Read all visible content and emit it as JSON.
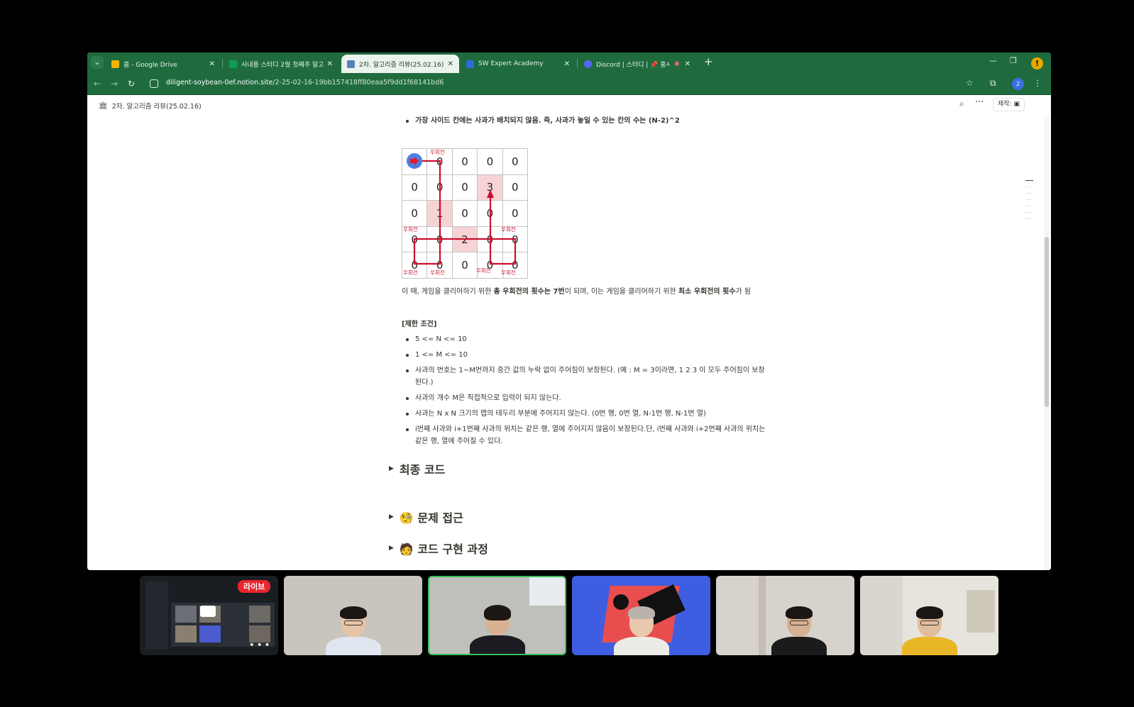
{
  "browser": {
    "tabs": [
      {
        "title": "흠 - Google Drive",
        "favicon": "drive-icon",
        "color": "#f4b400"
      },
      {
        "title": "사내용 스터디 2월 첫째주 알고",
        "favicon": "sheets-icon",
        "color": "#0f9d58"
      },
      {
        "title": "2차. 알고리즘 리뷰(25.02.16)",
        "favicon": "notion-icon",
        "color": "#5a7fb8",
        "active": true
      },
      {
        "title": "SW Expert Academy",
        "favicon": "swea-icon",
        "color": "#2b6cd8"
      },
      {
        "title": "Discord | 스터디 | 📌 홍시",
        "favicon": "discord-icon",
        "color": "#5865f2"
      }
    ],
    "url_host": "diligent-soybean-0ef.notion.site",
    "url_path": "/2-25-02-16-19bb157418ff80eaa5f9dd1f68141bd6"
  },
  "notion": {
    "breadcrumb": "2차. 알고리즘 리뷰(25.02.16)",
    "made_label": "제작:",
    "bullet_top": "가장 사이드 칸에는 사과가 배치되지 않음. 즉, 사과가 놓일 수 있는 칸의 수는 (N-2)^2",
    "grid": [
      [
        "➡",
        "0",
        "0",
        "0",
        "0"
      ],
      [
        "0",
        "0",
        "0",
        "3",
        "0"
      ],
      [
        "0",
        "1",
        "0",
        "0",
        "0"
      ],
      [
        "0",
        "0",
        "2",
        "0",
        "0"
      ],
      [
        "0",
        "0",
        "0",
        "0",
        "0"
      ]
    ],
    "grid_rotation_label": "우회전",
    "para_1": "이 때, 게임을 클리어하기 위한 ",
    "para_2": "총 우회전의 횟수는 7번",
    "para_3": "이 되며, 이는 게임을 클리어하기 위한 ",
    "para_4": "최소 우회전의 횟수",
    "para_5": "가 됨",
    "conditions_title": "[제한 조건]",
    "conditions": [
      "5 <= N <= 10",
      "1 <= M <= 10",
      "사과의 번호는 1~M번까지 중간 값의 누락 없이 주어짐이 보장된다. (예 : M = 3이라면, 1 2 3 이 모두 주어짐이 보장된다.)",
      "사과의 개수 M은 직접적으로 입력이 되지 않는다.",
      "사과는 N x N 크기의 맵의 테두리 부분에 주어지지 않는다. (0번 행, 0번 열, N-1번 행, N-1번 열)",
      "i번째 사과와 i+1번째 사과의 위치는 같은 행, 열에 주어지지 않음이 보장된다.단, i번째 사과와 i+2번째 사과의 위치는 같은 행, 열에 주어질 수 있다."
    ],
    "toggles": [
      "최종 코드",
      "🧐 문제 접근",
      "🧑 코드 구현 과정"
    ]
  },
  "meeting": {
    "live_label": "라이브",
    "participants": [
      {
        "name": "screen-share"
      },
      {
        "name": "participant-2",
        "bg": "#c9c4bd",
        "shirt": "#dfe6f0"
      },
      {
        "name": "participant-3",
        "bg": "#bfc0bc",
        "shirt": "#1a1c22",
        "speaking": true
      },
      {
        "name": "participant-4",
        "bg": "#3f5de0",
        "shirt": "#ecebe6"
      },
      {
        "name": "participant-5",
        "bg": "#d7d3cc",
        "shirt": "#1b1b1b"
      },
      {
        "name": "participant-6",
        "bg": "#e7e4dd",
        "shirt": "#e9b628"
      }
    ]
  }
}
